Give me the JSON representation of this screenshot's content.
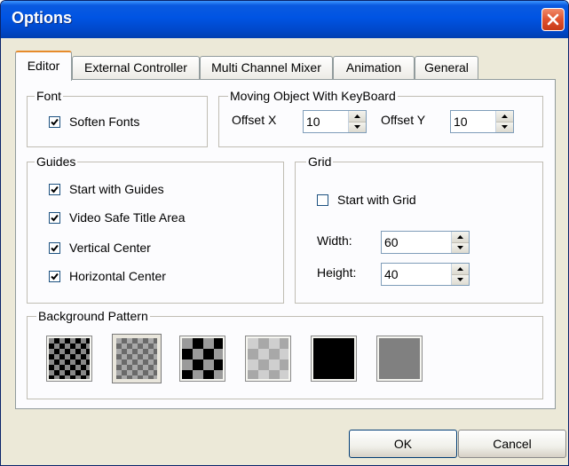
{
  "window": {
    "title": "Options",
    "accent": "#0054e3"
  },
  "tabs": [
    {
      "label": "Editor",
      "active": true
    },
    {
      "label": "External Controller",
      "active": false
    },
    {
      "label": "Multi Channel Mixer",
      "active": false
    },
    {
      "label": "Animation",
      "active": false
    },
    {
      "label": "General",
      "active": false
    }
  ],
  "font_group": {
    "legend": "Font",
    "soften_fonts": {
      "label": "Soften Fonts",
      "checked": true
    }
  },
  "moving_group": {
    "legend": "Moving Object With KeyBoard",
    "offset_x": {
      "label": "Offset X",
      "value": "10"
    },
    "offset_y": {
      "label": "Offset Y",
      "value": "10"
    }
  },
  "guides_group": {
    "legend": "Guides",
    "items": [
      {
        "label": "Start with Guides",
        "checked": true
      },
      {
        "label": "Video Safe Title Area",
        "checked": true
      },
      {
        "label": "Vertical Center",
        "checked": true
      },
      {
        "label": "Horizontal Center",
        "checked": true
      }
    ]
  },
  "grid_group": {
    "legend": "Grid",
    "start_with_grid": {
      "label": "Start with Grid",
      "checked": false
    },
    "width": {
      "label": "Width:",
      "value": "60"
    },
    "height": {
      "label": "Height:",
      "value": "40"
    }
  },
  "background_group": {
    "legend": "Background Pattern",
    "patterns": [
      {
        "name": "fine-black-checker",
        "selected": false
      },
      {
        "name": "fine-gray-checker",
        "selected": true
      },
      {
        "name": "coarse-black-checker",
        "selected": false
      },
      {
        "name": "coarse-gray-checker",
        "selected": false
      },
      {
        "name": "solid-black",
        "selected": false
      },
      {
        "name": "solid-gray",
        "selected": false
      }
    ]
  },
  "buttons": {
    "ok": "OK",
    "cancel": "Cancel"
  },
  "icons": {
    "close": "close-icon",
    "check": "checkmark-icon",
    "spin_up": "spin-up-icon",
    "spin_down": "spin-down-icon"
  }
}
